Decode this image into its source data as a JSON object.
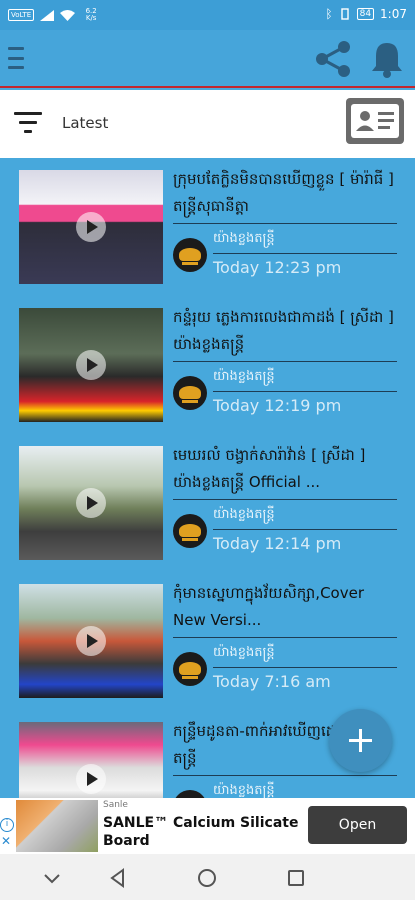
{
  "status_bar": {
    "left_badge": "VoLTE",
    "speed": "6.2 K/s",
    "battery": "84",
    "time": "1:07"
  },
  "app_bar": {
    "icons": [
      "menu-icon",
      "share-icon",
      "bell-icon"
    ]
  },
  "sort": {
    "label": "Latest"
  },
  "feed": [
    {
      "title": "ក្រុមបតែក្លិនមិនបានឃើញខ្លួន [ ម៉ារ៉ាធី ] តន្ត្រីសុធានីត្តា",
      "channel": "យ៉ាងខ្លងតន្ត្រី",
      "time": "Today 12:23 pm"
    },
    {
      "title": "កន្ទំរុយ ភ្លេងការលេងជាកាដង់ [ ស្រីដា ] យ៉ាងខ្លងតន្ត្រី",
      "channel": "យ៉ាងខ្លងតន្ត្រី",
      "time": "Today 12:19 pm"
    },
    {
      "title": "មេឃរលំ ចង្វាក់សារ៉ាវ៉ាន់ [ ស្រីដា ] យ៉ាងខ្លងតន្ត្រី Official ...",
      "channel": "យ៉ាងខ្លងតន្ត្រី",
      "time": "Today 12:14 pm"
    },
    {
      "title": "កុំមានស្នេហាក្នុងវ័យសិក្សា,Cover New Versi...",
      "channel": "យ៉ាងខ្លងតន្ត្រី",
      "time": "Today 7:16 am"
    },
    {
      "title": "កន្ទ្រឹមដូនតា-ពាក់អាវឃើញដោះ ចង្វាក់តន្ត្រី",
      "channel": "យ៉ាងខ្លងតន្ត្រី",
      "time": ""
    }
  ],
  "ad": {
    "brand": "Sanle",
    "title": "SANLE™ Calcium Silicate Board",
    "cta": "Open"
  },
  "colors": {
    "background": "#47a8dc",
    "app_bar": "#46a5da",
    "accent_line": "#c3262d",
    "fab": "#3f8fbe"
  }
}
